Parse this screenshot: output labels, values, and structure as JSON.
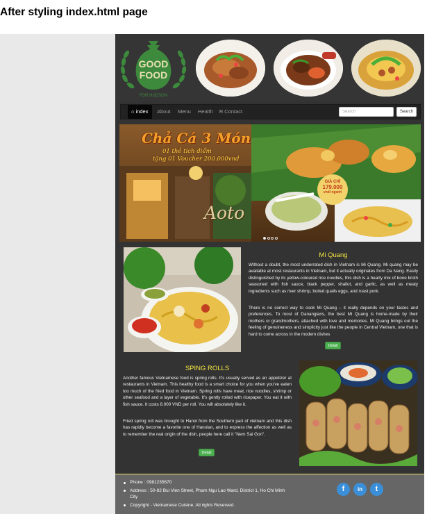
{
  "document": {
    "title": "After styling index.html page"
  },
  "header": {
    "logo": {
      "line1": "GOOD",
      "line2": "FOOD",
      "line3": "FOR HUDSON"
    }
  },
  "nav": {
    "items": [
      {
        "label": "index",
        "icon": "home-icon",
        "active": true
      },
      {
        "label": "About"
      },
      {
        "label": "Menu"
      },
      {
        "label": "Health"
      },
      {
        "label": "Contact",
        "icon": "envelope-icon"
      }
    ],
    "search": {
      "placeholder": "Search",
      "button_label": "Search"
    }
  },
  "carousel": {
    "promo_title": "Chả Cá 3 Món",
    "promo_line1": "01 thẻ tích điểm",
    "promo_line2": "tặng 01 Voucher 200.000vnd",
    "price_label": "GIÁ CHỈ",
    "price": "179.000",
    "price_unit": "vnd/ người",
    "restaurant_sign": "Aoto",
    "dots": 4,
    "active_dot": 0
  },
  "articles": [
    {
      "title": "Mi Quang",
      "paragraphs": [
        "Without a doubt, the most underrated dish in Vietnam is Mi Quang. Mi quang may be available at most restaurants in Vietnam, but it actually originates from Da Nang. Easily distinguished by its yellow-coloured rice noodles, this dish is a hearty mix of bone broth seasoned with fish sauce, black pepper, shallot, and garlic, as well as meaty ingredients such as river shrimp, boiled quails eggs, and roast pork.",
        "There is no correct way to cook Mi Quang – it really depends on your tastes and preferences. To most of Danangians, the best Mi Quang is home-made by their mothers or grandmothers, attached with love and memories. Mi Quang brings out the feeling of genuineness and simplicity just like the people in Central Vietnam, one that is hard to come across in the modern dishes"
      ],
      "button_label": "Detail"
    },
    {
      "title": "SPING ROLLS",
      "paragraphs": [
        "Another famous Vietnamese food is spring rolls. It's usually served as an appetizer at restaurants in Vietnam. This healthy food is a smart choice for you when you've eaten too much of the fried food in Vietnam. Spring rolls have meat, rice noodles, shrimp or other seafood and a layer of vegetable. It's gently rolled with ricepaper. You eat it with fish sauce. It costs 8.000 VND per roll. You will absolutely like it.",
        "Fried spring roll was brought to Hanoi from the Southern part of vietnam and this dish has rapidly become a favorite one of Hanoian, and to express the affection as well as to remember the real origin of the dish, people here call it \"Nem Sai Gon\"."
      ],
      "button_label": "Detail"
    }
  ],
  "footer": {
    "items": [
      "Phone : 0981235670",
      "Address : 50-82 Bui Vien Street, Pham Ngu Lao Ward, District 1, Ho Chi Minh City",
      "Copyright - Vietnamese Cuisine. All rights Reserved."
    ],
    "social": [
      {
        "icon": "facebook-icon",
        "glyph": "f"
      },
      {
        "icon": "linkedin-icon",
        "glyph": "in"
      },
      {
        "icon": "twitter-icon",
        "glyph": "t"
      }
    ]
  },
  "colors": {
    "page_bg": "#333333",
    "nav_bg": "#222222",
    "heading": "#f5e642",
    "button": "#4caf50",
    "footer_bg": "#666666",
    "social": "#3a8fd8"
  }
}
